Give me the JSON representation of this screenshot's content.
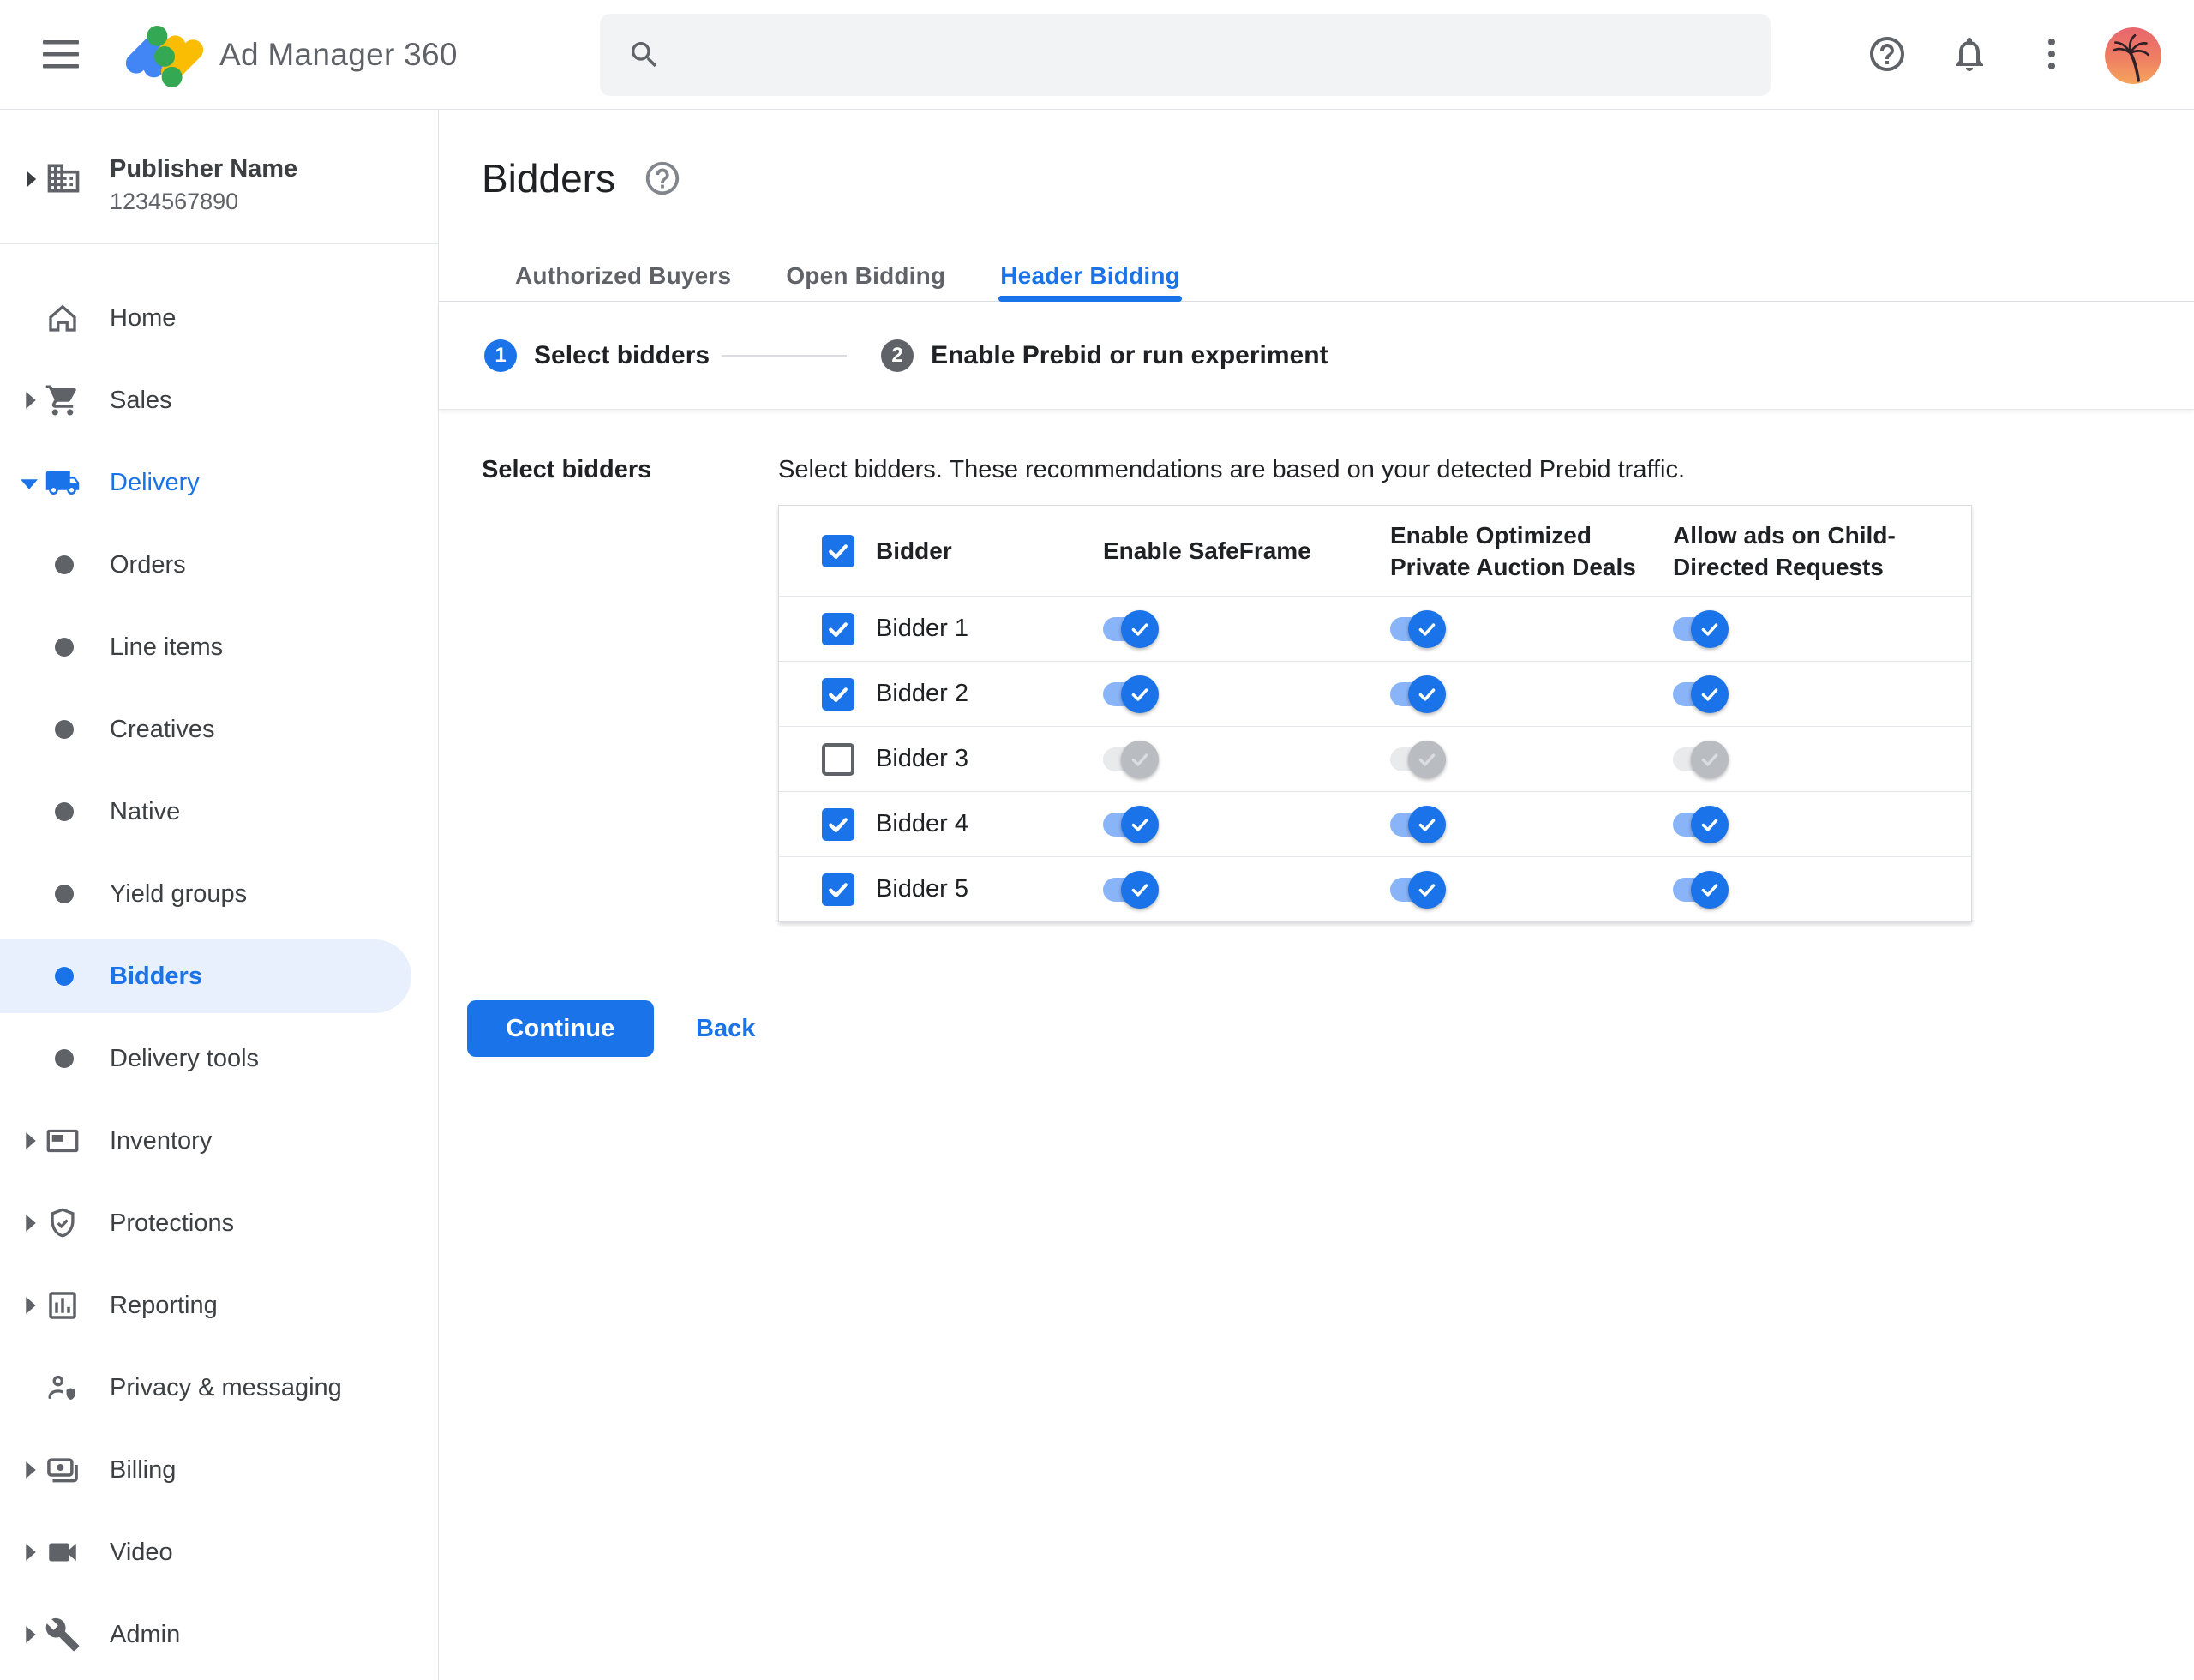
{
  "topbar": {
    "brand": "Ad Manager 360",
    "search": {
      "placeholder": "",
      "value": ""
    },
    "icons": [
      "menu-icon",
      "ad-manager-logo",
      "search-icon",
      "help-icon",
      "notifications-icon",
      "more-vertical-icon",
      "avatar-palm-tree"
    ]
  },
  "sidebar": {
    "publisher": {
      "name": "Publisher Name",
      "id": "1234567890",
      "icon": "building-icon",
      "expander": "chevron-right-icon"
    },
    "items": [
      {
        "label": "Home",
        "icon": "home-icon",
        "type": "top",
        "arrow": "none",
        "state": "normal"
      },
      {
        "label": "Sales",
        "icon": "cart-icon",
        "type": "top",
        "arrow": "collapsed",
        "state": "normal"
      },
      {
        "label": "Delivery",
        "icon": "truck-icon",
        "type": "top",
        "arrow": "expanded",
        "state": "section-active"
      },
      {
        "label": "Orders",
        "type": "sub",
        "state": "normal"
      },
      {
        "label": "Line items",
        "type": "sub",
        "state": "normal"
      },
      {
        "label": "Creatives",
        "type": "sub",
        "state": "normal"
      },
      {
        "label": "Native",
        "type": "sub",
        "state": "normal"
      },
      {
        "label": "Yield groups",
        "type": "sub",
        "state": "normal"
      },
      {
        "label": "Bidders",
        "type": "sub",
        "state": "selected"
      },
      {
        "label": "Delivery tools",
        "type": "sub",
        "state": "normal"
      },
      {
        "label": "Inventory",
        "icon": "inventory-icon",
        "type": "top",
        "arrow": "collapsed",
        "state": "normal"
      },
      {
        "label": "Protections",
        "icon": "shield-check-icon",
        "type": "top",
        "arrow": "collapsed",
        "state": "normal"
      },
      {
        "label": "Reporting",
        "icon": "bar-chart-icon",
        "type": "top",
        "arrow": "collapsed",
        "state": "normal"
      },
      {
        "label": "Privacy & messaging",
        "icon": "person-shield-icon",
        "type": "top",
        "arrow": "none",
        "state": "normal"
      },
      {
        "label": "Billing",
        "icon": "payments-icon",
        "type": "top",
        "arrow": "collapsed",
        "state": "normal"
      },
      {
        "label": "Video",
        "icon": "videocam-icon",
        "type": "top",
        "arrow": "collapsed",
        "state": "normal"
      },
      {
        "label": "Admin",
        "icon": "wrench-icon",
        "type": "top",
        "arrow": "collapsed",
        "state": "normal"
      }
    ]
  },
  "page": {
    "title": "Bidders",
    "help_icon": "help-icon",
    "tabs": [
      {
        "label": "Authorized Buyers",
        "active": false
      },
      {
        "label": "Open Bidding",
        "active": false
      },
      {
        "label": "Header Bidding",
        "active": true
      }
    ],
    "stepper": [
      {
        "number": "1",
        "label": "Select bidders",
        "state": "active"
      },
      {
        "number": "2",
        "label": "Enable Prebid or run experiment",
        "state": "upcoming"
      }
    ]
  },
  "content": {
    "section_label": "Select bidders",
    "description": "Select bidders. These recommendations are based on your detected Prebid traffic.",
    "table": {
      "select_all_checked": true,
      "columns": [
        "Bidder",
        "Enable SafeFrame",
        "Enable Optimized Private Auction Deals",
        "Allow ads on Child-Directed Requests"
      ],
      "rows": [
        {
          "name": "Bidder 1",
          "selected": true,
          "enabled": true,
          "safeframe_on": true,
          "optimized_deals_on": true,
          "child_directed_on": true
        },
        {
          "name": "Bidder 2",
          "selected": true,
          "enabled": true,
          "safeframe_on": true,
          "optimized_deals_on": true,
          "child_directed_on": true
        },
        {
          "name": "Bidder 3",
          "selected": false,
          "enabled": false,
          "safeframe_on": true,
          "optimized_deals_on": true,
          "child_directed_on": true
        },
        {
          "name": "Bidder 4",
          "selected": true,
          "enabled": true,
          "safeframe_on": true,
          "optimized_deals_on": true,
          "child_directed_on": true
        },
        {
          "name": "Bidder 5",
          "selected": true,
          "enabled": true,
          "safeframe_on": true,
          "optimized_deals_on": true,
          "child_directed_on": true
        }
      ]
    },
    "actions": {
      "continue_label": "Continue",
      "back_label": "Back"
    }
  },
  "colors": {
    "primary_blue": "#1a73e8",
    "toggle_track_on": "#8ab4f8",
    "toggle_track_off": "#e9eaec",
    "toggle_thumb_off": "#b9bcc1",
    "selected_item_bg": "#e8f0fe",
    "text_dark": "#202124",
    "text_gray": "#5f6368",
    "border": "#dadce0",
    "search_bg": "#f1f3f4",
    "step_upcoming": "#5f6368",
    "logo_blue": "#4285f4",
    "logo_yellow": "#fbbc04",
    "logo_green": "#34a853"
  }
}
